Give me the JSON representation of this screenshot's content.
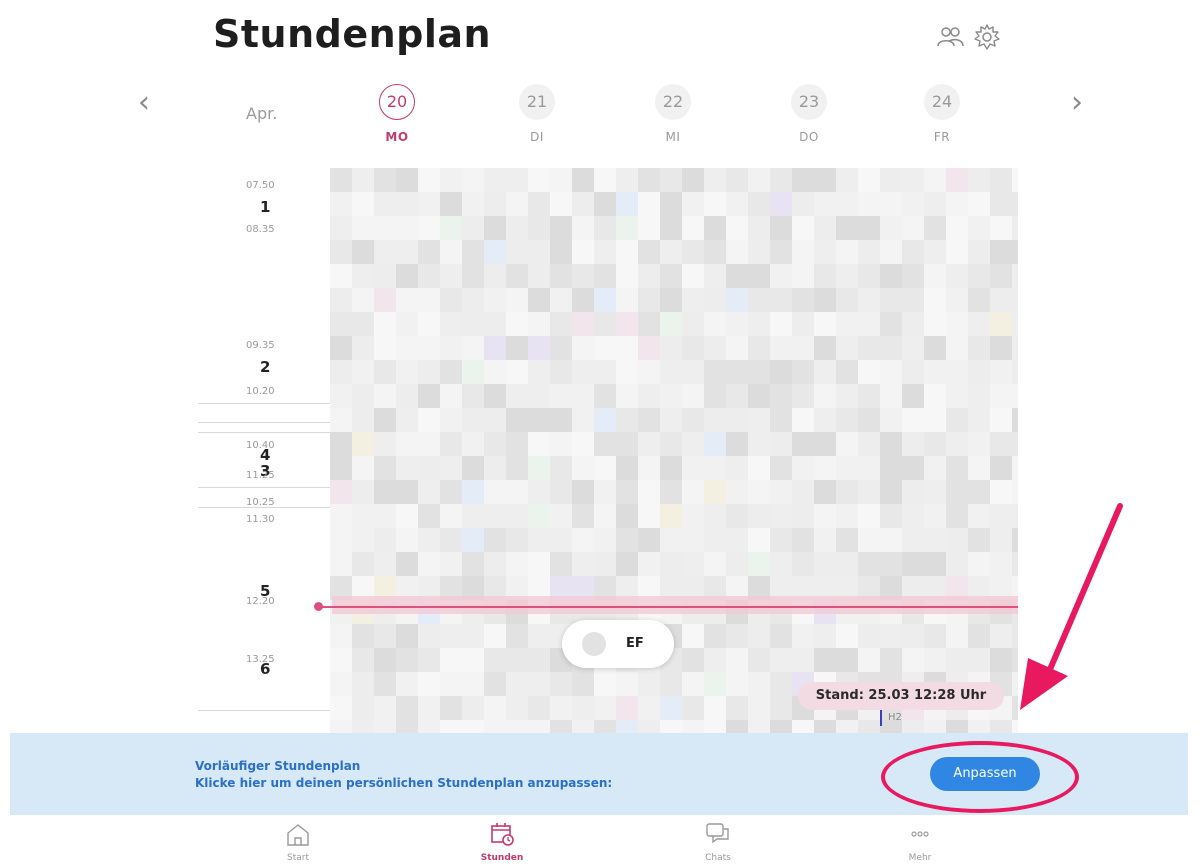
{
  "header": {
    "title": "Stundenplan",
    "icons": [
      "people-icon",
      "gear-icon"
    ]
  },
  "week": {
    "month": "Apr.",
    "days": [
      {
        "num": "20",
        "wd": "MO",
        "active": true
      },
      {
        "num": "21",
        "wd": "DI",
        "active": false
      },
      {
        "num": "22",
        "wd": "MI",
        "active": false
      },
      {
        "num": "23",
        "wd": "DO",
        "active": false
      },
      {
        "num": "24",
        "wd": "FR",
        "active": false
      }
    ],
    "prev": "‹",
    "next": "›"
  },
  "periods": [
    {
      "start": "07.50",
      "num": "1",
      "end": "08.35"
    },
    {
      "start": "09.35",
      "num": "2",
      "end": "10.20"
    },
    {
      "start": "10.40",
      "num": "4",
      "end": "11.25"
    },
    {
      "start": "",
      "num": "3",
      "end": ""
    },
    {
      "start": "10.25",
      "num": "",
      "end": "11.30"
    },
    {
      "start": "12.20",
      "num": "5",
      "end": ""
    },
    {
      "start": "13.25",
      "num": "6",
      "end": ""
    }
  ],
  "current_lesson": {
    "label": "EF"
  },
  "stand": "Stand: 25.03 12:28 Uhr",
  "room": "H2",
  "banner": {
    "title": "Vorläufiger Stundenplan",
    "text": "Klicke hier um deinen persönlichen Stundenplan anzupassen:",
    "button": "Anpassen"
  },
  "tabs": [
    {
      "label": "Start",
      "icon": "home-icon",
      "active": false
    },
    {
      "label": "Stunden",
      "icon": "calendar-clock-icon",
      "active": true
    },
    {
      "label": "Chats",
      "icon": "chat-icon",
      "active": false
    },
    {
      "label": "Mehr",
      "icon": "more-icon",
      "active": false
    }
  ],
  "colors": {
    "accent": "#c53a6e",
    "button": "#2f87e3",
    "banner": "#d7e8f7",
    "annotation": "#e8195e"
  }
}
